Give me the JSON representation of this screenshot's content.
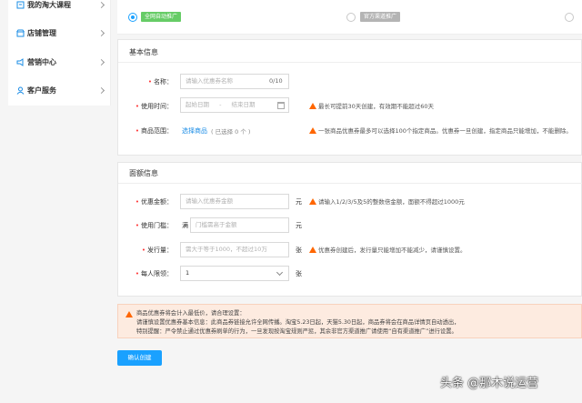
{
  "sidebar": {
    "items": [
      {
        "label": "我的淘大课程",
        "icon": "course-icon"
      },
      {
        "label": "店铺管理",
        "icon": "store-icon"
      },
      {
        "label": "营销中心",
        "icon": "megaphone-icon"
      },
      {
        "label": "客户服务",
        "icon": "customer-icon"
      }
    ]
  },
  "channel": {
    "options": [
      {
        "label": "全网自动推广",
        "selected": true
      },
      {
        "label": "官方渠道推广",
        "selected": false
      }
    ]
  },
  "basic": {
    "title": "基本信息",
    "name_label": "名称：",
    "name_placeholder": "请输入优惠券名称",
    "name_counter": "0/10",
    "time_label": "使用时间：",
    "start_placeholder": "起始日期",
    "time_sep": "-",
    "end_placeholder": "结束日期",
    "time_warn": "最长可提前30天创建，有效期不能超过60天",
    "range_label": "商品范围：",
    "range_link": "选择商品",
    "range_hint": "( 已选择 0 个 )",
    "range_warn": "一张商品优惠券最多可以选择100个指定商品。优惠券一旦创建，指定商品只能增加，不能删除。"
  },
  "amount": {
    "title": "面额信息",
    "value_label": "优惠金额：",
    "value_placeholder": "请输入优惠券金额",
    "value_unit": "元",
    "value_warn": "请输入1/2/3/5及5的整数倍金额，面额不得超过1000元",
    "threshold_label": "使用门槛：",
    "threshold_prefix": "满",
    "threshold_placeholder": "门槛需高于金额",
    "threshold_unit": "元",
    "qty_label": "发行量：",
    "qty_placeholder": "需大于等于1000，不超过10万",
    "qty_unit": "张",
    "qty_warn": "优惠券创建后，发行量只能增加不能减少，请谨慎设置。",
    "limit_label": "每人限领：",
    "limit_value": "1",
    "limit_unit": "张"
  },
  "notice": {
    "lines": [
      "商品优惠券将会计入最低价，请合理设置：",
      "请谨慎设置优惠券基本信息：此商品券链接允许全网传播。淘宝5.23日起，天猫5.30日起，商品券将会在商品详情页自动透出，",
      "特别提醒：严令禁止通过优惠券刷单的行为，一旦发现按淘宝规则严惩，其余非官方渠道推广请使用“自有渠道推广”进行设置。"
    ]
  },
  "submit_label": "确认创建",
  "watermark": "头条 @那木说运营",
  "colors": {
    "accent": "#1aa1ff",
    "warn": "#ff6600",
    "tag_green": "#66cc66"
  }
}
